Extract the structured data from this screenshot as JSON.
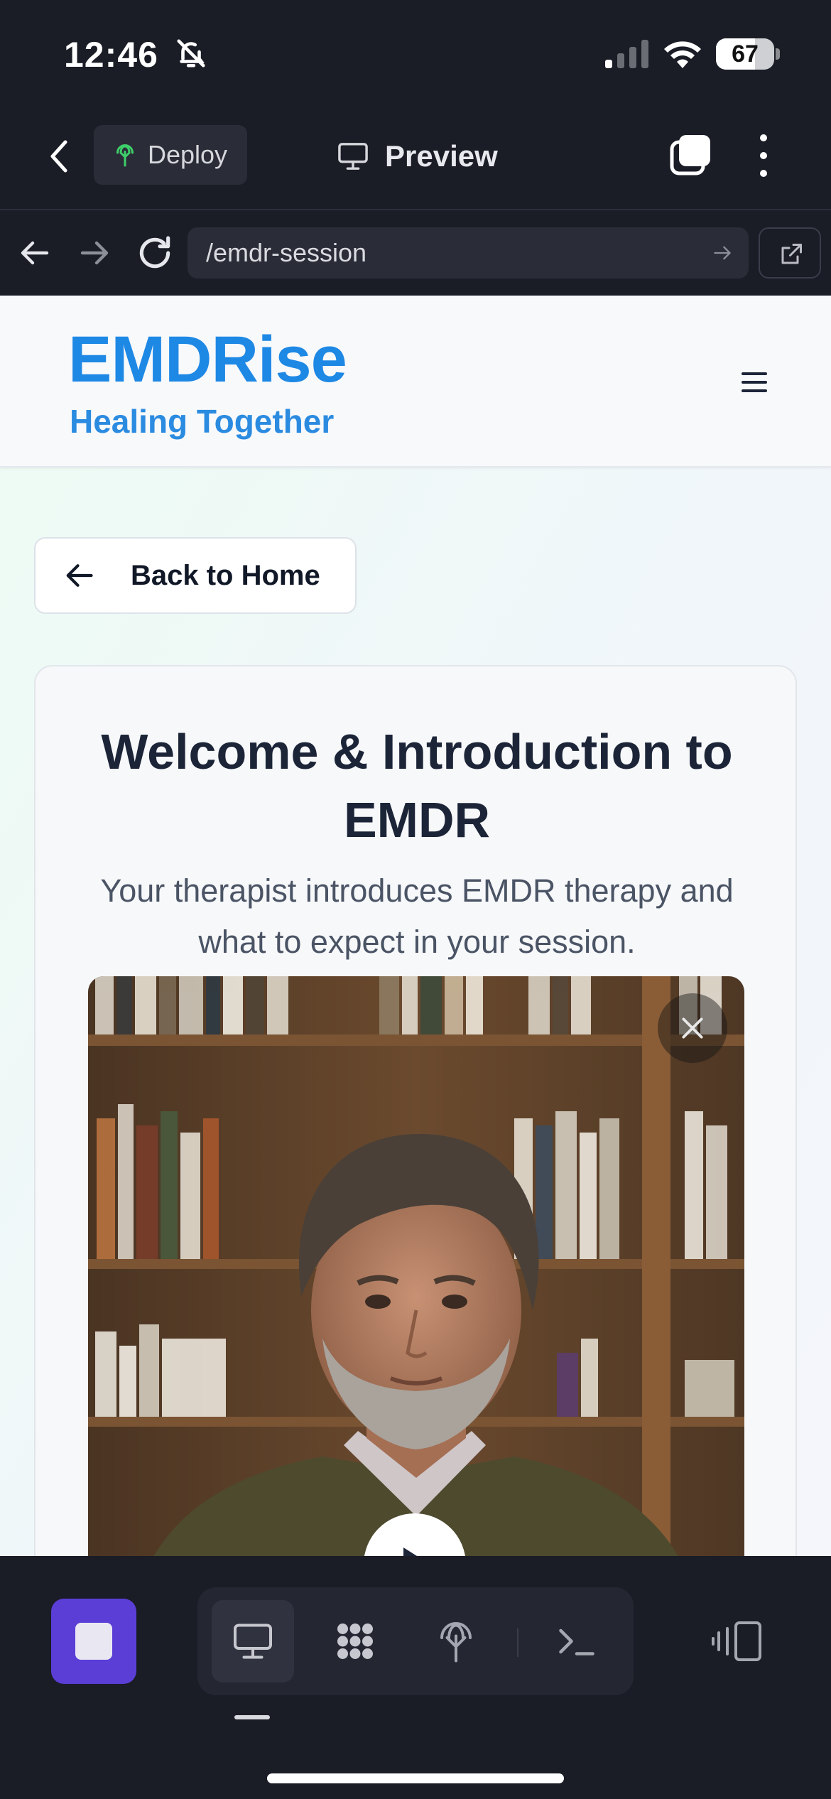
{
  "status": {
    "time": "12:46",
    "battery": "67",
    "battery_level": 0.67
  },
  "toolbar": {
    "deploy_label": "Deploy",
    "preview_label": "Preview"
  },
  "browser": {
    "url": "/emdr-session"
  },
  "site": {
    "logo": "EMDRise",
    "tagline": "Healing Together",
    "back_label": "Back to Home",
    "card_title": "Welcome & Introduction to EMDR",
    "card_subtitle": "Your therapist introduces EMDR therapy and what to expect in your session."
  },
  "icons": {
    "bell": "bell-slash-icon",
    "signal": "signal-icon",
    "wifi": "wifi-icon",
    "back": "chevron-left-icon",
    "deploy": "deploy-tree-icon",
    "preview": "monitor-icon",
    "tabs": "tabs-icon",
    "more": "more-vertical-icon",
    "nav_back": "arrow-left-icon",
    "nav_forward": "arrow-right-icon",
    "reload": "reload-icon",
    "open_external": "external-link-icon",
    "menu": "hamburger-menu-icon",
    "close": "close-icon",
    "play": "play-icon",
    "dock_preview": "monitor-icon",
    "dock_apps": "grid-icon",
    "dock_deploy": "deploy-tree-icon",
    "dock_terminal": "terminal-icon",
    "dock_device": "device-icon"
  },
  "colors": {
    "accent": "#1e88e5",
    "stop_button": "#5b3ed6",
    "dark_bg": "#1a1c26"
  }
}
